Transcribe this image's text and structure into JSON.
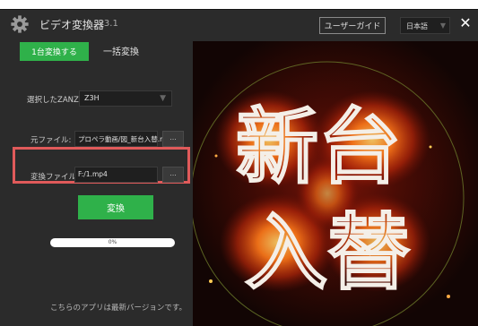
{
  "window": {
    "title": "ビデオ変換器",
    "version": "v3.1",
    "guide_label": "ユーザーガイド",
    "language": "日本語",
    "close_symbol": "✕"
  },
  "tabs": [
    {
      "label": "1台変換する",
      "active": true
    },
    {
      "label": "一括変換",
      "active": false
    }
  ],
  "fields": {
    "zanzo_label": "選択したZANZO:",
    "zanzo_value": "Z3H",
    "source_label": "元ファイル:",
    "source_value": "プロペラ動画/図_新台入替.mp4",
    "source_browse": "...",
    "output_label": "変換ファイル:",
    "output_value": "F:/1.mp4",
    "output_browse": "..."
  },
  "convert_label": "変換",
  "progress": {
    "value": 0,
    "label": "0%"
  },
  "version_note": "こちらのアプリは最新バージョンです。",
  "preview": {
    "line1": "新台",
    "line2": "入替"
  },
  "colors": {
    "accent": "#2fb14a",
    "highlight": "#e05a5a",
    "background": "#2b2b2b"
  },
  "icons": {
    "app": "gear-icon",
    "dropdown": "caret-down-icon",
    "close": "close-icon"
  }
}
